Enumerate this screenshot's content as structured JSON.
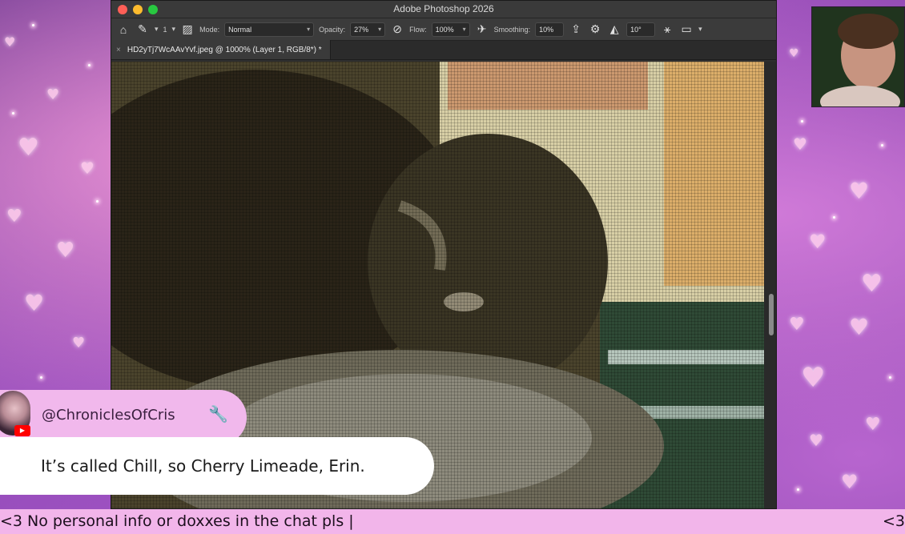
{
  "photoshop": {
    "window_title": "Adobe Photoshop 2026",
    "options_bar": {
      "brush_size": "1",
      "mode_label": "Mode:",
      "mode_value": "Normal",
      "opacity_label": "Opacity:",
      "opacity_value": "27%",
      "flow_label": "Flow:",
      "flow_value": "100%",
      "smoothing_label": "Smoothing:",
      "smoothing_value": "10%",
      "angle_value": "10°"
    },
    "document_tab": "HD2yTj7WcAAvYvf.jpeg @ 1000% (Layer 1, RGB/8*) *",
    "tab_close": "×"
  },
  "chat": {
    "username": "@ChroniclesOfCris",
    "message": "It’s called Chill, so Cherry Limeade, Erin."
  },
  "ticker": {
    "text": "<3 No personal info or doxxes in the chat pls |",
    "right_text": "<3"
  },
  "icons": {
    "home": "home-icon",
    "brush": "brush-icon",
    "wrench": "wrench-icon",
    "youtube": "youtube-icon"
  }
}
